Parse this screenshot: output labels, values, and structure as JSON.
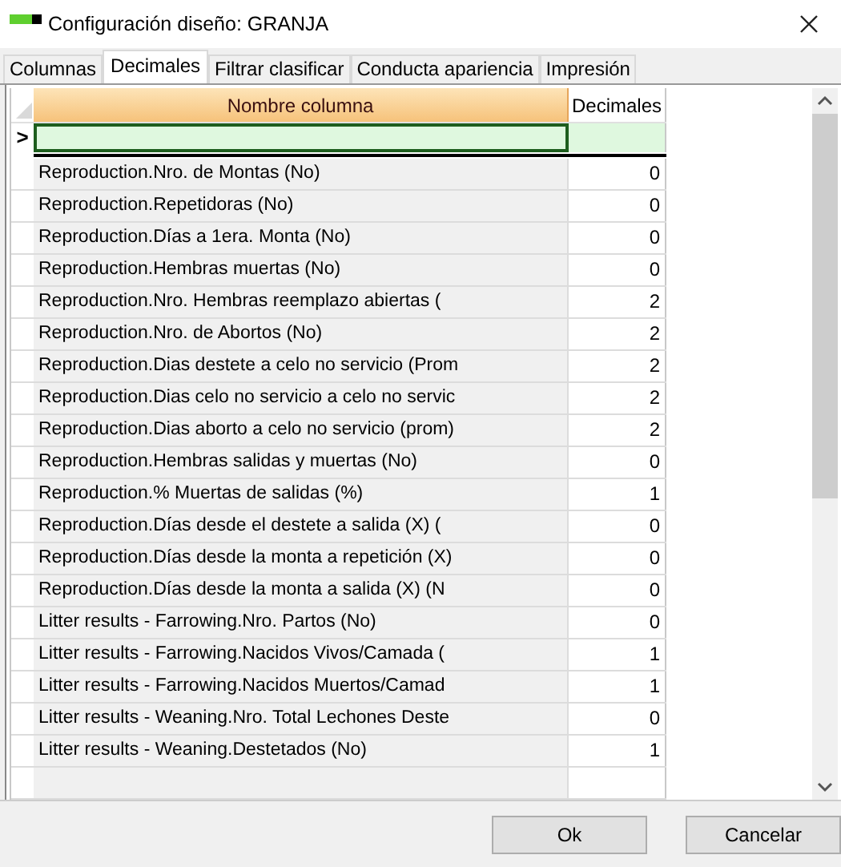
{
  "window": {
    "title": "Configuración diseño: GRANJA"
  },
  "tabs": [
    {
      "label": "Columnas",
      "selected": false
    },
    {
      "label": "Decimales",
      "selected": true
    },
    {
      "label": "Filtrar  clasificar",
      "selected": false
    },
    {
      "label": "Conducta  apariencia",
      "selected": false
    },
    {
      "label": "Impresión",
      "selected": false
    }
  ],
  "table": {
    "columns": [
      "Nombre columna",
      "Decimales"
    ],
    "current_row_marker": ">",
    "rows": [
      {
        "name": "Reproduction.Nro. de Montas (No)",
        "decimals": "0"
      },
      {
        "name": "Reproduction.Repetidoras (No)",
        "decimals": "0"
      },
      {
        "name": "Reproduction.Días a 1era. Monta (No)",
        "decimals": "0"
      },
      {
        "name": "Reproduction.Hembras muertas (No)",
        "decimals": "0"
      },
      {
        "name": "Reproduction.Nro. Hembras reemplazo abiertas (",
        "decimals": "2"
      },
      {
        "name": "Reproduction.Nro. de Abortos (No)",
        "decimals": "2"
      },
      {
        "name": "Reproduction.Dias destete a celo no servicio (Prom",
        "decimals": "2"
      },
      {
        "name": "Reproduction.Dias celo no servicio a celo no servic",
        "decimals": "2"
      },
      {
        "name": "Reproduction.Dias aborto a celo no servicio (prom)",
        "decimals": "2"
      },
      {
        "name": "Reproduction.Hembras salidas y muertas (No)",
        "decimals": "0"
      },
      {
        "name": "Reproduction.% Muertas de salidas (%)",
        "decimals": "1"
      },
      {
        "name": "Reproduction.Días desde el destete a salida (X) (",
        "decimals": "0"
      },
      {
        "name": "Reproduction.Días desde la monta a repetición (X)",
        "decimals": "0"
      },
      {
        "name": "Reproduction.Días desde la monta a salida (X) (N",
        "decimals": "0"
      },
      {
        "name": "Litter results - Farrowing.Nro. Partos (No)",
        "decimals": "0"
      },
      {
        "name": "Litter results - Farrowing.Nacidos Vivos/Camada (",
        "decimals": "1"
      },
      {
        "name": "Litter results - Farrowing.Nacidos Muertos/Camad",
        "decimals": "1"
      },
      {
        "name": "Litter results - Weaning.Nro. Total Lechones Deste",
        "decimals": "0"
      },
      {
        "name": "Litter results - Weaning.Destetados (No)",
        "decimals": "1"
      }
    ]
  },
  "buttons": [
    "Ok",
    "Cancelar"
  ]
}
